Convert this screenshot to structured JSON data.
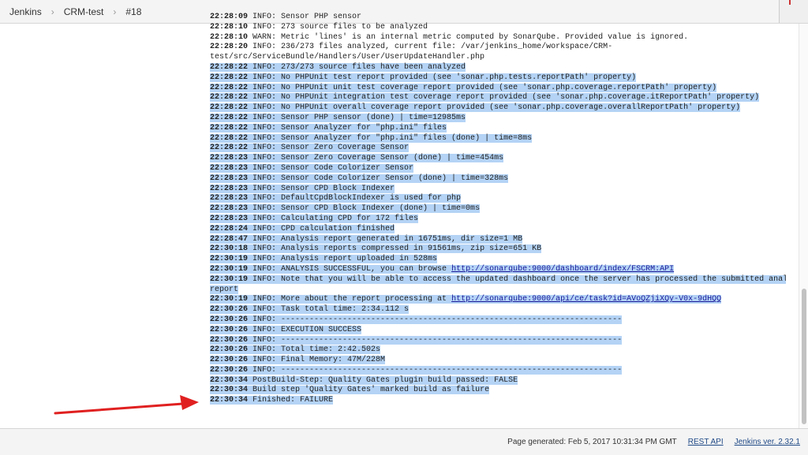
{
  "breadcrumb": [
    "Jenkins",
    "CRM-test",
    "#18"
  ],
  "console_lines": [
    {
      "ts": "22:28:09",
      "text": " INFO: Sensor PHP sensor",
      "selected": false
    },
    {
      "ts": "22:28:10",
      "text": " INFO: 273 source files to be analyzed",
      "selected": false
    },
    {
      "ts": "22:28:10",
      "text": " WARN: Metric 'lines' is an internal metric computed by SonarQube. Provided value is ignored.",
      "selected": false
    },
    {
      "ts": "22:28:20",
      "text": " INFO: 236/273 files analyzed, current file: /var/jenkins_home/workspace/CRM-",
      "selected": false
    },
    {
      "ts": "",
      "text": "test/src/ServiceBundle/Handlers/User/UserUpdateHandler.php",
      "selected": false
    },
    {
      "ts": "22:28:22",
      "text": " INFO: 273/273 source files have been analyzed",
      "selected": true
    },
    {
      "ts": "22:28:22",
      "text": " INFO: No PHPUnit test report provided (see 'sonar.php.tests.reportPath' property)",
      "selected": true
    },
    {
      "ts": "22:28:22",
      "text": " INFO: No PHPUnit unit test coverage report provided (see 'sonar.php.coverage.reportPath' property)",
      "selected": true
    },
    {
      "ts": "22:28:22",
      "text": " INFO: No PHPUnit integration test coverage report provided (see 'sonar.php.coverage.itReportPath' property)",
      "selected": true
    },
    {
      "ts": "22:28:22",
      "text": " INFO: No PHPUnit overall coverage report provided (see 'sonar.php.coverage.overallReportPath' property)",
      "selected": true
    },
    {
      "ts": "22:28:22",
      "text": " INFO: Sensor PHP sensor (done) | time=12985ms",
      "selected": true
    },
    {
      "ts": "22:28:22",
      "text": " INFO: Sensor Analyzer for \"php.ini\" files",
      "selected": true
    },
    {
      "ts": "22:28:22",
      "text": " INFO: Sensor Analyzer for \"php.ini\" files (done) | time=8ms",
      "selected": true
    },
    {
      "ts": "22:28:22",
      "text": " INFO: Sensor Zero Coverage Sensor",
      "selected": true
    },
    {
      "ts": "22:28:23",
      "text": " INFO: Sensor Zero Coverage Sensor (done) | time=454ms",
      "selected": true
    },
    {
      "ts": "22:28:23",
      "text": " INFO: Sensor Code Colorizer Sensor",
      "selected": true
    },
    {
      "ts": "22:28:23",
      "text": " INFO: Sensor Code Colorizer Sensor (done) | time=328ms",
      "selected": true
    },
    {
      "ts": "22:28:23",
      "text": " INFO: Sensor CPD Block Indexer",
      "selected": true
    },
    {
      "ts": "22:28:23",
      "text": " INFO: DefaultCpdBlockIndexer is used for php",
      "selected": true
    },
    {
      "ts": "22:28:23",
      "text": " INFO: Sensor CPD Block Indexer (done) | time=0ms",
      "selected": true
    },
    {
      "ts": "22:28:23",
      "text": " INFO: Calculating CPD for 172 files",
      "selected": true
    },
    {
      "ts": "22:28:24",
      "text": " INFO: CPD calculation finished",
      "selected": true
    },
    {
      "ts": "22:28:47",
      "text": " INFO: Analysis report generated in 16751ms, dir size=1 MB",
      "selected": true
    },
    {
      "ts": "22:30:18",
      "text": " INFO: Analysis reports compressed in 91561ms, zip size=651 KB",
      "selected": true
    },
    {
      "ts": "22:30:19",
      "text": " INFO: Analysis report uploaded in 528ms",
      "selected": true
    },
    {
      "ts": "22:30:19",
      "text": " INFO: ANALYSIS SUCCESSFUL, you can browse ",
      "link": "http://sonarqube:9000/dashboard/index/FSCRM:API",
      "selected": true
    },
    {
      "ts": "22:30:19",
      "text": " INFO: Note that you will be able to access the updated dashboard once the server has processed the submitted analysis",
      "selected": true
    },
    {
      "ts": "",
      "text": "report",
      "selected": true
    },
    {
      "ts": "22:30:19",
      "text": " INFO: More about the report processing at ",
      "link": "http://sonarqube:9000/api/ce/task?id=AVoQZjiXQy-V0x-9dHQQ",
      "selected": true
    },
    {
      "ts": "22:30:26",
      "text": " INFO: Task total time: 2:34.112 s",
      "selected": true
    },
    {
      "ts": "22:30:26",
      "text": " INFO: ------------------------------------------------------------------------",
      "selected": true
    },
    {
      "ts": "22:30:26",
      "text": " INFO: EXECUTION SUCCESS",
      "selected": true
    },
    {
      "ts": "22:30:26",
      "text": " INFO: ------------------------------------------------------------------------",
      "selected": true
    },
    {
      "ts": "22:30:26",
      "text": " INFO: Total time: 2:42.502s",
      "selected": true
    },
    {
      "ts": "22:30:26",
      "text": " INFO: Final Memory: 47M/228M",
      "selected": true
    },
    {
      "ts": "22:30:26",
      "text": " INFO: ------------------------------------------------------------------------",
      "selected": true
    },
    {
      "ts": "22:30:34",
      "text": " PostBuild-Step: Quality Gates plugin build passed: FALSE",
      "selected": true
    },
    {
      "ts": "22:30:34",
      "text": " Build step 'Quality Gates' marked build as failure",
      "selected": true
    },
    {
      "ts": "22:30:34",
      "text": " Finished: FAILURE",
      "selected": true
    }
  ],
  "footer": {
    "generated": "Page generated: Feb 5, 2017 10:31:34 PM GMT",
    "rest_api": "REST API",
    "version": "Jenkins ver. 2.32.1"
  },
  "colors": {
    "selection": "#b4d3f5",
    "annotation_arrow": "#e02020",
    "link": "#1a1a9a"
  }
}
